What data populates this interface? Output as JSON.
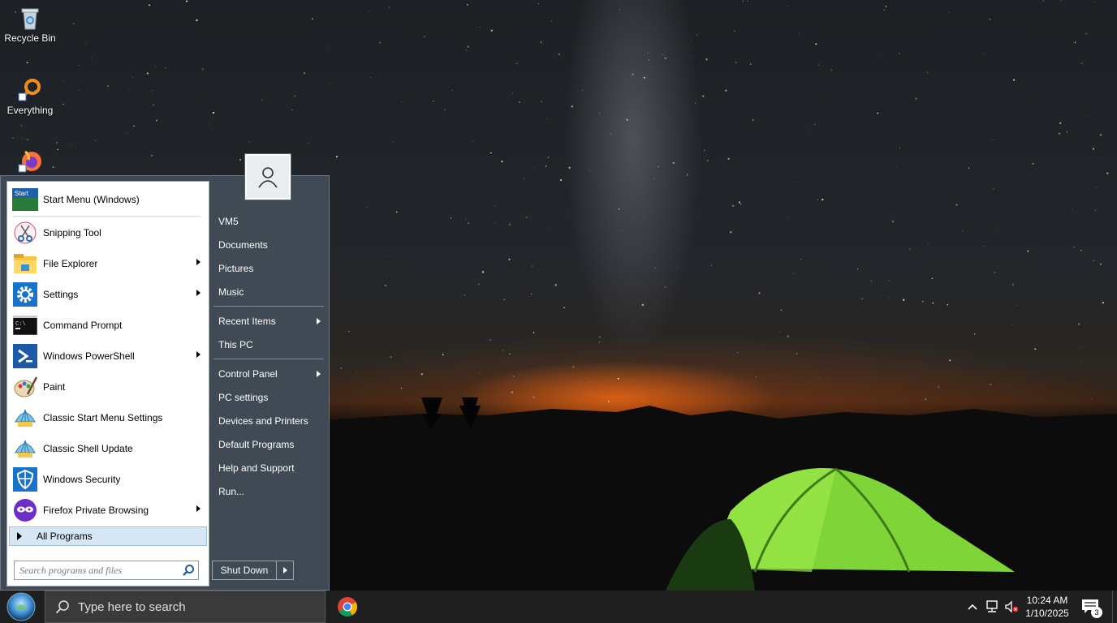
{
  "desktop": {
    "icons": [
      {
        "label": "Recycle Bin",
        "icon": "recycle-bin-icon"
      },
      {
        "label": "Everything",
        "icon": "everything-search-icon"
      },
      {
        "label": "",
        "icon": "firefox-icon"
      }
    ]
  },
  "start_menu": {
    "pinned": [
      {
        "label": "Start Menu (Windows)",
        "icon": "start-menu-icon",
        "submenu": false
      },
      {
        "label": "Snipping Tool",
        "icon": "snipping-tool-icon",
        "submenu": false
      },
      {
        "label": "File Explorer",
        "icon": "folder-icon",
        "submenu": true
      },
      {
        "label": "Settings",
        "icon": "gear-icon",
        "submenu": true
      },
      {
        "label": "Command Prompt",
        "icon": "command-prompt-icon",
        "submenu": false
      },
      {
        "label": "Windows PowerShell",
        "icon": "powershell-icon",
        "submenu": true
      },
      {
        "label": "Paint",
        "icon": "paint-icon",
        "submenu": false
      },
      {
        "label": "Classic Start Menu Settings",
        "icon": "shell-icon",
        "submenu": false
      },
      {
        "label": "Classic Shell Update",
        "icon": "shell-icon",
        "submenu": false
      },
      {
        "label": "Windows Security",
        "icon": "shield-icon",
        "submenu": false
      },
      {
        "label": "Firefox Private Browsing",
        "icon": "firefox-private-icon",
        "submenu": true
      }
    ],
    "all_programs": "All Programs",
    "search_placeholder": "Search programs and files",
    "right_items": [
      {
        "label": "VM5",
        "submenu": false
      },
      {
        "label": "Documents",
        "submenu": false
      },
      {
        "label": "Pictures",
        "submenu": false
      },
      {
        "label": "Music",
        "submenu": false
      },
      {
        "label": "Recent Items",
        "submenu": true
      },
      {
        "label": "This PC",
        "submenu": false
      },
      {
        "label": "Control Panel",
        "submenu": true
      },
      {
        "label": "PC settings",
        "submenu": false
      },
      {
        "label": "Devices and Printers",
        "submenu": false
      },
      {
        "label": "Default Programs",
        "submenu": false
      },
      {
        "label": "Help and Support",
        "submenu": false
      },
      {
        "label": "Run...",
        "submenu": false
      }
    ],
    "shutdown_label": "Shut Down"
  },
  "taskbar": {
    "search_placeholder": "Type here to search",
    "time": "10:24 AM",
    "date": "1/10/2025",
    "notification_count": "3",
    "pinned_apps": [
      "chrome-icon"
    ],
    "tray_icons": [
      "chevron-up-icon",
      "network-icon",
      "volume-muted-icon"
    ]
  },
  "colors": {
    "menu_bg": "#3f4a54",
    "taskbar_bg": "#1f1f1f",
    "highlight": "#d7e6f4"
  }
}
